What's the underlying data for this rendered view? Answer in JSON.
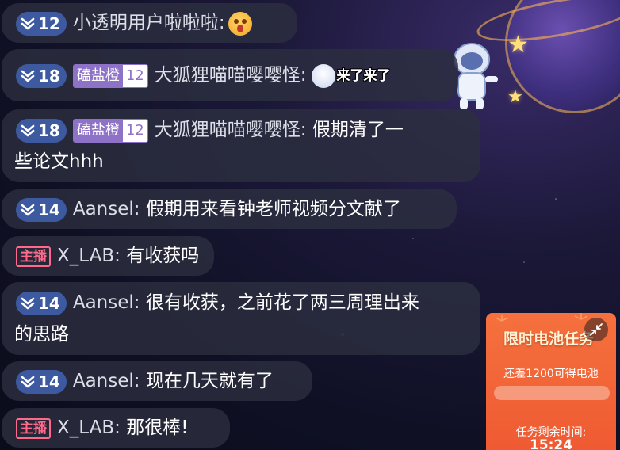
{
  "chat": {
    "messages": [
      {
        "level": "12",
        "user": "小透明用户啦啦啦:",
        "text": "",
        "emoji": "shocked-face-emoji"
      },
      {
        "level": "18",
        "fan_name": "磕盐橙",
        "fan_level": "12",
        "user": "大狐狸喵喵嘤嘤怪:",
        "text": "",
        "sticker_text": "来了来了"
      },
      {
        "level": "18",
        "fan_name": "磕盐橙",
        "fan_level": "12",
        "user": "大狐狸喵喵嘤嘤怪:",
        "text_line1": "假期清了一",
        "text_line2": "些论文hhh"
      },
      {
        "level": "14",
        "user": "Aansel:",
        "text": "假期用来看钟老师视频分文献了"
      },
      {
        "host_badge": "主播",
        "user": "X_LAB:",
        "text": "有收获吗"
      },
      {
        "level": "14",
        "user": "Aansel:",
        "text_line1": "很有收获，之前花了两三周理出来",
        "text_line2": "的思路"
      },
      {
        "level": "14",
        "user": "Aansel:",
        "text": "现在几天就有了"
      },
      {
        "host_badge": "主播",
        "user": "X_LAB:",
        "text": "那很棒!"
      }
    ]
  },
  "task": {
    "title": "限时电池任务",
    "subtitle": "还差1200可得电池",
    "remaining_label": "任务剩余时间:",
    "time": "15:24",
    "progress": 0.0,
    "accent": "#f5713e"
  }
}
